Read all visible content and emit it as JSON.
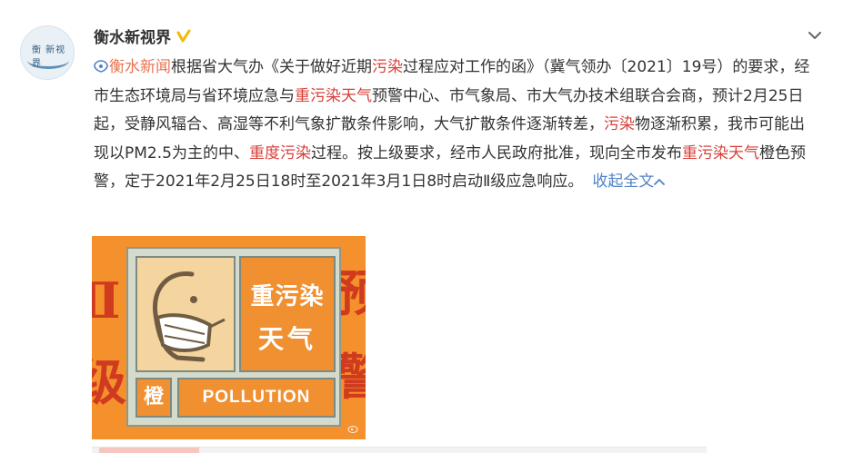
{
  "user": {
    "name": "衡水新视界",
    "avatar_text": "衡水新视界"
  },
  "post": {
    "segments": [
      {
        "text": "衡水新闻",
        "style": "link"
      },
      {
        "text": "根据省大气办《关于做好近期",
        "style": "plain"
      },
      {
        "text": "污染",
        "style": "hl"
      },
      {
        "text": "过程应对工作的函》（冀气领办〔2021〕19号）的要求，经市生态环境局与省环境应急与",
        "style": "plain"
      },
      {
        "text": "重污染天气",
        "style": "hl"
      },
      {
        "text": "预警中心、市气象局、市大气办技术组联合会商，预计2月25日起，受静风辐合、高湿等不利气象扩散条件影响，大气扩散条件逐渐转差，",
        "style": "plain"
      },
      {
        "text": "污染",
        "style": "hl"
      },
      {
        "text": "物逐渐积累，我市可能出现以PM2.5为主的中、",
        "style": "plain"
      },
      {
        "text": "重度",
        "style": "hl"
      },
      {
        "text": "污染",
        "style": "hl"
      },
      {
        "text": "过程。按上级要求，经市人民政府批准，现向全市发布",
        "style": "plain"
      },
      {
        "text": "重污染天气",
        "style": "hl"
      },
      {
        "text": "橙色预警，定于2021年2月25日18时至2021年3月1日8时启动Ⅱ级应急响应。",
        "style": "plain"
      }
    ],
    "collapse_label": "收起全文"
  },
  "image": {
    "left_chars": [
      "Ⅱ",
      "级"
    ],
    "right_chars": [
      "预",
      "警"
    ],
    "sign_line1": "重污染",
    "sign_line2": "天气",
    "color_char": "橙",
    "pollution_label": "POLLUTION"
  },
  "icons": {
    "verified": "verified-badge-icon",
    "chevron": "chevron-down-icon",
    "location": "location-pin-icon",
    "collapse": "chevron-up-icon"
  },
  "colors": {
    "link": "#eb7350",
    "highlight": "#d8403a",
    "action_blue": "#5082c8",
    "verified": "#f6b800",
    "warning_orange": "#f4912c"
  }
}
